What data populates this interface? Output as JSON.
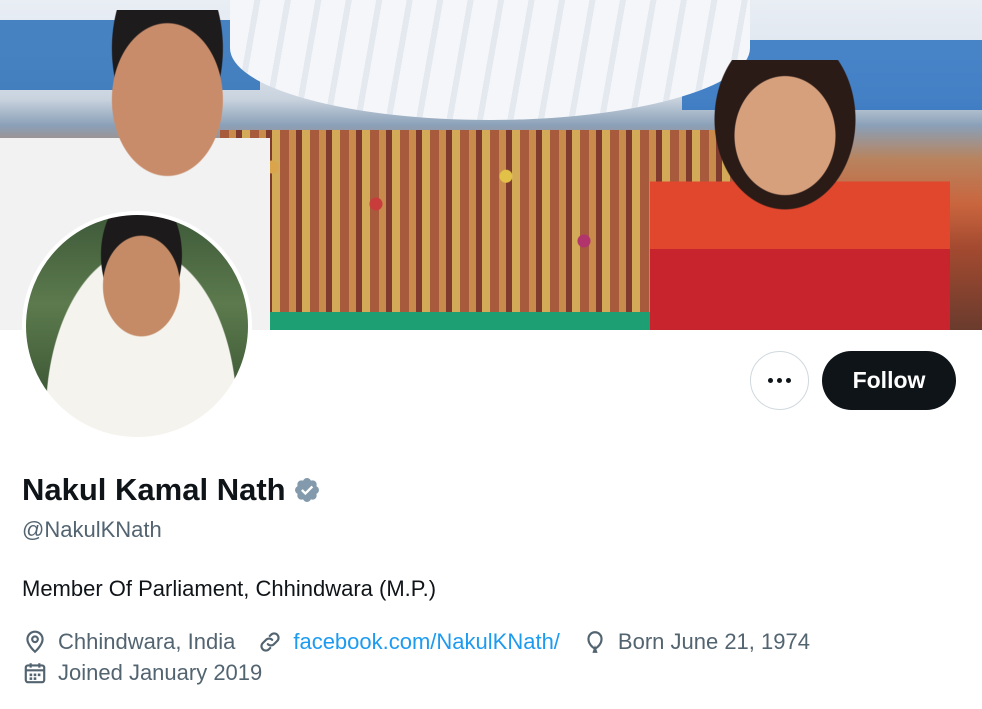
{
  "profile": {
    "display_name": "Nakul Kamal Nath",
    "handle": "@NakulKNath",
    "bio": "Member Of Parliament, Chhindwara (M.P.)",
    "verified": true,
    "verified_color": "#829aab"
  },
  "actions": {
    "follow_label": "Follow",
    "more_icon": "more-horizontal-icon"
  },
  "meta": {
    "location": "Chhindwara, India",
    "website": "facebook.com/NakulKNath/",
    "birthday": "Born June 21, 1974",
    "joined": "Joined January 2019"
  },
  "colors": {
    "text_primary": "#0f1419",
    "text_secondary": "#536471",
    "link": "#1d9bf0",
    "follow_bg": "#0f1419"
  }
}
